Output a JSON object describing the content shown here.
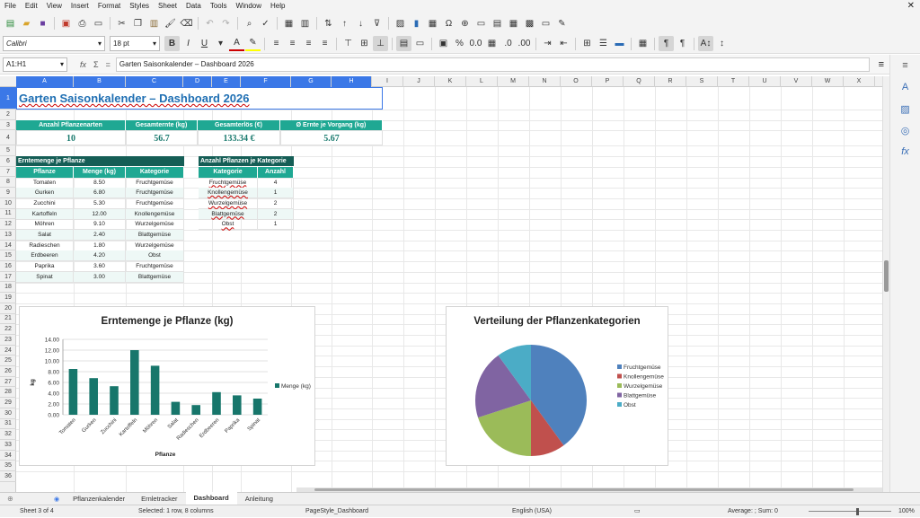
{
  "menu": [
    "File",
    "Edit",
    "View",
    "Insert",
    "Format",
    "Styles",
    "Sheet",
    "Data",
    "Tools",
    "Window",
    "Help"
  ],
  "font_name": "Calibri",
  "font_size": "18 pt",
  "name_box": "A1:H1",
  "formula": "Garten Saisonkalender – Dashboard 2026",
  "columns": [
    "A",
    "B",
    "C",
    "D",
    "E",
    "F",
    "G",
    "H",
    "I",
    "J",
    "K",
    "L",
    "M",
    "N",
    "O",
    "P",
    "Q",
    "R",
    "S",
    "T",
    "U",
    "V",
    "W",
    "X"
  ],
  "rows": [
    "1",
    "2",
    "3",
    "4",
    "5",
    "6",
    "7",
    "8",
    "9",
    "10",
    "11",
    "12",
    "13",
    "14",
    "15",
    "16",
    "17",
    "18",
    "19",
    "20",
    "21",
    "22",
    "23",
    "24",
    "25",
    "26",
    "27",
    "28",
    "29",
    "30",
    "31",
    "32",
    "33",
    "34",
    "35",
    "36"
  ],
  "title": "Garten Saisonkalender – Dashboard 2026",
  "kpis": [
    {
      "label": "Anzahl Pflanzenarten",
      "value": "10"
    },
    {
      "label": "Gesamternte (kg)",
      "value": "56.7"
    },
    {
      "label": "Gesamterlös (€)",
      "value": "133.34 €"
    },
    {
      "label": "Ø Ernte je Vorgang (kg)",
      "value": "5.67"
    }
  ],
  "harvest_table": {
    "title": "Erntemenge je Pflanze",
    "headers": [
      "Pflanze",
      "Menge (kg)",
      "Kategorie"
    ],
    "rows": [
      [
        "Tomaten",
        "8.50",
        "Fruchtgemüse"
      ],
      [
        "Gurken",
        "6.80",
        "Fruchtgemüse"
      ],
      [
        "Zucchini",
        "5.30",
        "Fruchtgemüse"
      ],
      [
        "Kartoffeln",
        "12.00",
        "Knollengemüse"
      ],
      [
        "Möhren",
        "9.10",
        "Wurzelgemüse"
      ],
      [
        "Salat",
        "2.40",
        "Blattgemüse"
      ],
      [
        "Radieschen",
        "1.80",
        "Wurzelgemüse"
      ],
      [
        "Erdbeeren",
        "4.20",
        "Obst"
      ],
      [
        "Paprika",
        "3.60",
        "Fruchtgemüse"
      ],
      [
        "Spinat",
        "3.00",
        "Blattgemüse"
      ]
    ]
  },
  "category_table": {
    "title": "Anzahl Pflanzen je Kategorie",
    "headers": [
      "Kategorie",
      "Anzahl"
    ],
    "rows": [
      [
        "Fruchtgemüse",
        "4"
      ],
      [
        "Knollengemüse",
        "1"
      ],
      [
        "Wurzelgemüse",
        "2"
      ],
      [
        "Blattgemüse",
        "2"
      ],
      [
        "Obst",
        "1"
      ]
    ]
  },
  "chart_data": [
    {
      "type": "bar",
      "title": "Erntemenge je Pflanze (kg)",
      "xlabel": "Pflanze",
      "ylabel": "kg",
      "categories": [
        "Tomaten",
        "Gurken",
        "Zucchini",
        "Kartoffeln",
        "Möhren",
        "Salat",
        "Radieschen",
        "Erdbeeren",
        "Paprika",
        "Spinat"
      ],
      "series": [
        {
          "name": "Menge (kg)",
          "values": [
            8.5,
            6.8,
            5.3,
            12.0,
            9.1,
            2.4,
            1.8,
            4.2,
            3.6,
            3.0
          ]
        }
      ],
      "yticks": [
        "0.00",
        "2.00",
        "4.00",
        "6.00",
        "8.00",
        "10.00",
        "12.00",
        "14.00"
      ],
      "ylim": [
        0,
        14
      ],
      "grid": true,
      "legend": "right",
      "color": "#17766b"
    },
    {
      "type": "pie",
      "title": "Verteilung der Pflanzenkategorien",
      "labels": [
        "Fruchtgemüse",
        "Knollengemüse",
        "Wurzelgemüse",
        "Blattgemüse",
        "Obst"
      ],
      "values": [
        4,
        1,
        2,
        2,
        1
      ],
      "colors": [
        "#4f81bd",
        "#c0504d",
        "#9bbb59",
        "#8064a2",
        "#4bacc6"
      ],
      "legend": "right"
    }
  ],
  "sheet_tabs": [
    "Pflanzenkalender",
    "Ernletracker",
    "Dashboard",
    "Anleitung"
  ],
  "active_tab": "Dashboard",
  "status": {
    "sheet": "Sheet 3 of 4",
    "selection": "Selected: 1 row, 8 columns",
    "page_style": "PageStyle_Dashboard",
    "language": "English (USA)",
    "summary": "Average: ; Sum: 0",
    "zoom": "100%"
  }
}
